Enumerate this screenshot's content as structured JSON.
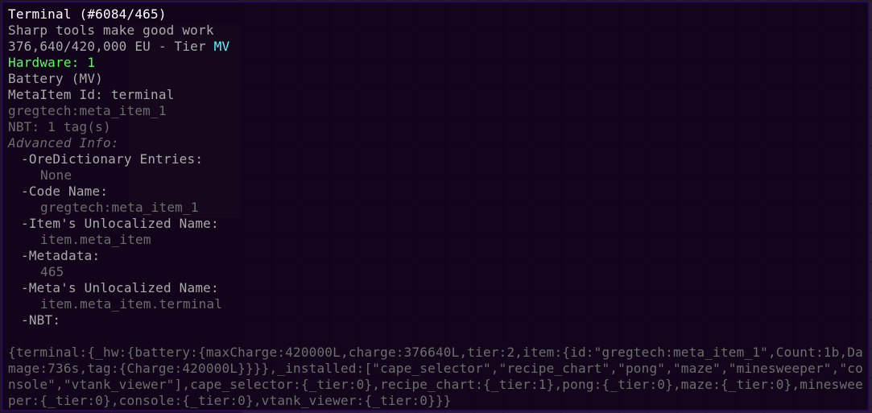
{
  "title": "Terminal (#6084/465)",
  "description": "Sharp tools make good work",
  "energy": {
    "amount": "376,640/420,000 EU - Tier ",
    "tier": "MV"
  },
  "hardware": "Hardware: 1",
  "battery": "Battery (MV)",
  "meta_item_id": "MetaItem Id: terminal",
  "registry_name": "gregtech:meta_item_1",
  "nbt_tags": "NBT: 1 tag(s)",
  "advanced_info_header": "Advanced Info:",
  "advanced": {
    "ore_dict_label": "-OreDictionary Entries:",
    "ore_dict_value": "None",
    "code_name_label": "-Code Name:",
    "code_name_value": "gregtech:meta_item_1",
    "unlocalized_label": "-Item's Unlocalized Name:",
    "unlocalized_value": "item.meta_item",
    "metadata_label": "-Metadata:",
    "metadata_value": "465",
    "meta_unlocalized_label": "-Meta's Unlocalized Name:",
    "meta_unlocalized_value": "item.meta_item.terminal",
    "nbt_label": "-NBT:"
  },
  "nbt_data": "{terminal:{_hw:{battery:{maxCharge:420000L,charge:376640L,tier:2,item:{id:\"gregtech:meta_item_1\",Count:1b,Damage:736s,tag:{Charge:420000L}}}},_installed:[\"cape_selector\",\"recipe_chart\",\"pong\",\"maze\",\"minesweeper\",\"console\",\"vtank_viewer\"],cape_selector:{_tier:0},recipe_chart:{_tier:1},pong:{_tier:0},maze:{_tier:0},minesweeper:{_tier:0},console:{_tier:0},vtank_viewer:{_tier:0}}}"
}
